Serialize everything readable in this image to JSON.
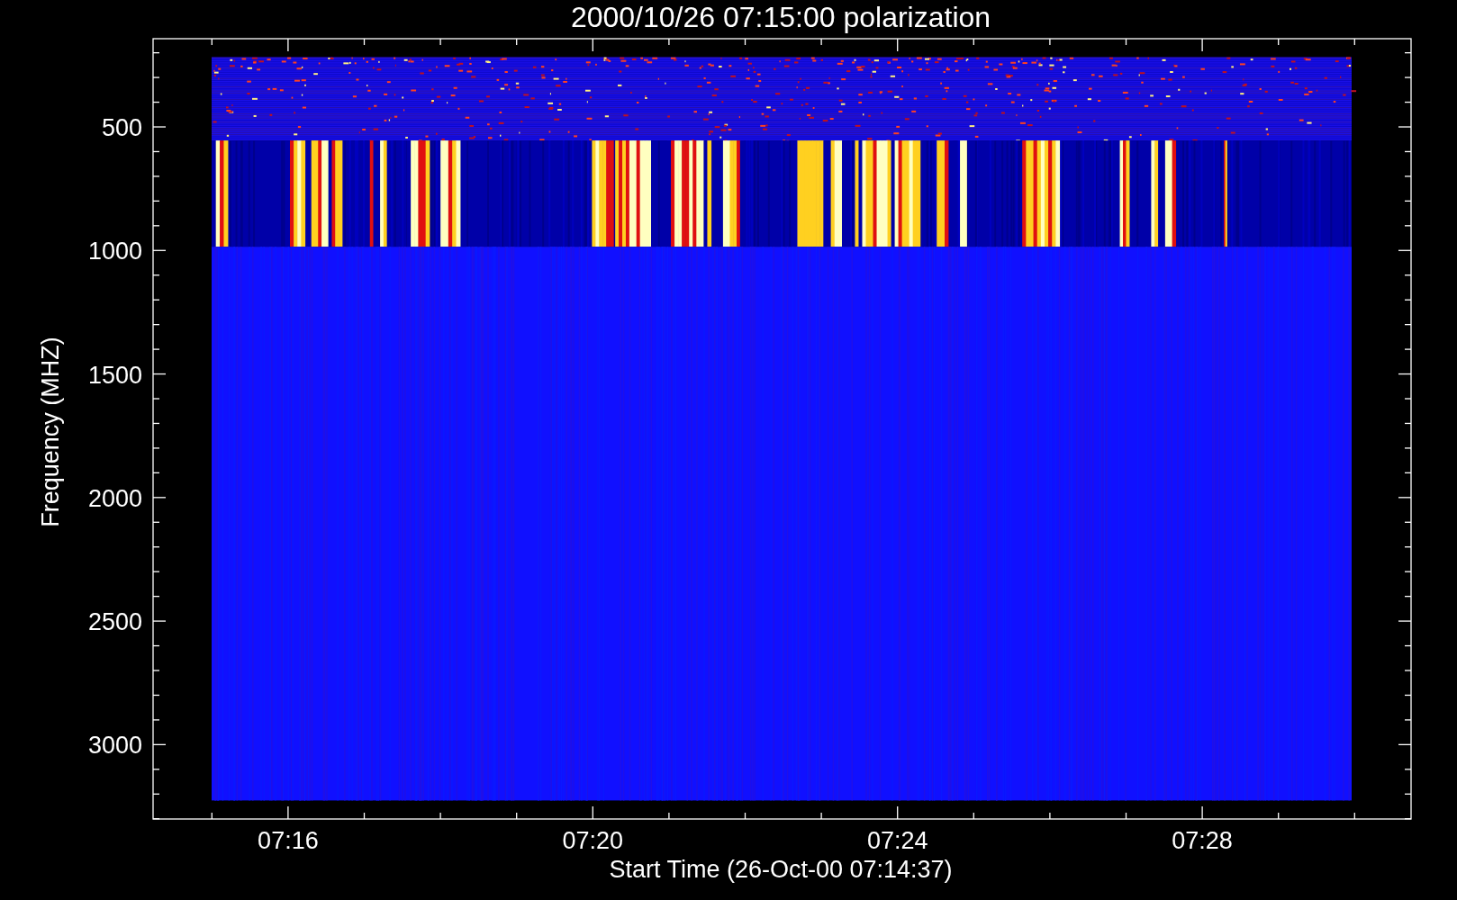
{
  "title": "2000/10/26 07:15:00 polarization",
  "y_axis": {
    "label": "Frequency (MHZ)",
    "ticks": [
      "500",
      "1000",
      "1500",
      "2000",
      "2500",
      "3000"
    ]
  },
  "x_axis": {
    "label": "Start Time (26-Oct-00 07:14:37)",
    "ticks": [
      "07:16",
      "07:20",
      "07:24",
      "07:28"
    ]
  }
}
